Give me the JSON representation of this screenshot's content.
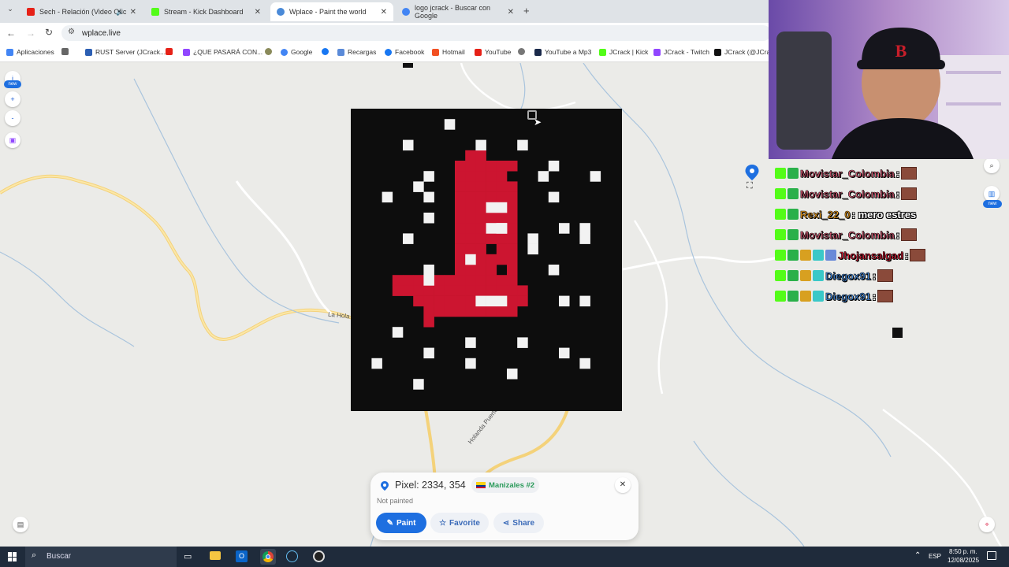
{
  "browser": {
    "tabs": [
      {
        "label": "Sech - Relación (Video Ofic",
        "favicon_color": "#e62117",
        "audio": true
      },
      {
        "label": "Stream - Kick Dashboard",
        "favicon_color": "#53fc18"
      },
      {
        "label": "Wplace - Paint the world",
        "favicon_color": "#4a8ad8",
        "active": true
      },
      {
        "label": "logo jcrack - Buscar con Google",
        "favicon_color": "#4285f4"
      }
    ],
    "url": "wplace.live",
    "bookmarks": [
      {
        "label": "Aplicaciones",
        "icon": "apps-grid-icon"
      },
      {
        "label": "RUST Server (JCrack...",
        "icon": "rust-icon"
      },
      {
        "label": "",
        "icon": "youtube-icon"
      },
      {
        "label": "¿QUE PASARÁ CON...",
        "icon": "twitch-icon"
      },
      {
        "label": "Google",
        "icon": "google-icon"
      },
      {
        "label": "",
        "icon": "facebook-icon"
      },
      {
        "label": "Recargas",
        "icon": "recargas-icon"
      },
      {
        "label": "Facebook",
        "icon": "facebook-icon"
      },
      {
        "label": "Hotmail",
        "icon": "windows-icon"
      },
      {
        "label": "YouTube",
        "icon": "youtube-icon"
      },
      {
        "label": "",
        "icon": "globe-icon"
      },
      {
        "label": "YouTube a Mp3",
        "icon": "mp3-icon"
      },
      {
        "label": "JCrack | Kick",
        "icon": "kick-icon"
      },
      {
        "label": "JCrack - Twitch",
        "icon": "twitch-icon"
      },
      {
        "label": "JCrack (@JCrac",
        "icon": "x-icon"
      }
    ]
  },
  "map": {
    "side_controls": {
      "info": "i",
      "info_badge": "new",
      "zoom_in": "+",
      "zoom_out": "-"
    },
    "right_controls": {
      "badge": "new"
    },
    "road_labels": [
      "La Hola",
      "Holanda Puerto Nare"
    ]
  },
  "card": {
    "pixel_label": "Pixel: 2334, 354",
    "region": "Manizales #2",
    "status": "Not painted",
    "paint_label": "Paint",
    "favorite_label": "Favorite",
    "share_label": "Share",
    "accent": "#1e6fe0"
  },
  "chat": [
    {
      "name": "Movistar_Colombia",
      "color": "#e0607a",
      "msg": ":",
      "emote": true
    },
    {
      "name": "Movistar_Colombia",
      "color": "#e0607a",
      "msg": ":",
      "emote": true
    },
    {
      "name": "Rexi_22_0",
      "color": "#f0a020",
      "msg": ": mero estres",
      "emote": false
    },
    {
      "name": "Movistar_Colombia",
      "color": "#e0607a",
      "msg": ":",
      "emote": true
    },
    {
      "name": "Jhojansalgad",
      "color": "#e0203a",
      "msg": ":",
      "emote": true
    },
    {
      "name": "Diegox91",
      "color": "#4a90e2",
      "msg": ":",
      "emote": true
    },
    {
      "name": "Diegox91",
      "color": "#4a90e2",
      "msg": ":",
      "emote": true
    }
  ],
  "taskbar": {
    "search_placeholder": "Buscar",
    "lang": "ESP",
    "time": "8:50 p. m.",
    "date": "12/08/2025"
  }
}
